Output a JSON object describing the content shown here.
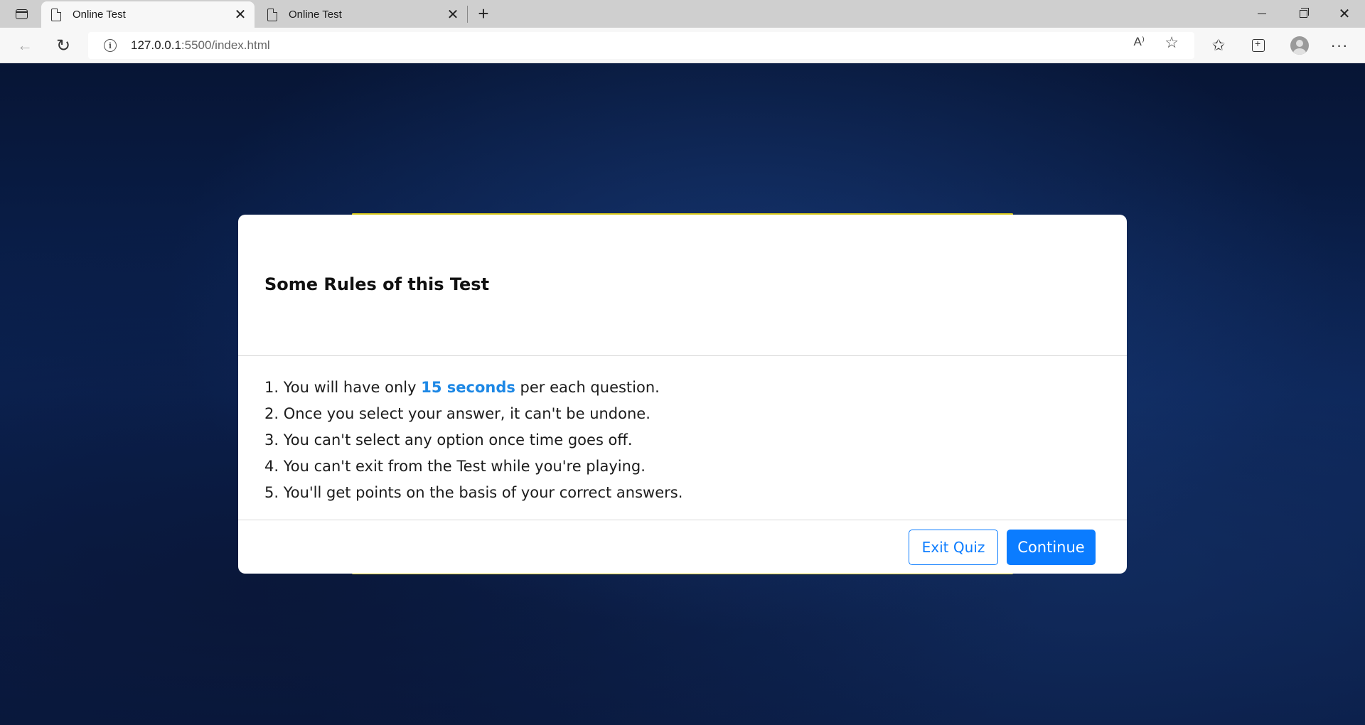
{
  "browser": {
    "tabs": [
      {
        "title": "Online Test",
        "active": true
      },
      {
        "title": "Online Test",
        "active": false
      }
    ],
    "close_glyph": "✕",
    "new_tab_glyph": "+",
    "window_close_glyph": "✕",
    "url": {
      "host": "127.0.0.1",
      "path": ":5500/index.html"
    },
    "back_glyph": "←",
    "reload_glyph": "↻",
    "info_glyph": "i",
    "read_aloud_glyph": "A⁾",
    "fav_add_glyph": "☆",
    "favorites_glyph": "✩",
    "more_glyph": "···"
  },
  "quiz": {
    "title": "Some Rules of this Test",
    "rules": [
      {
        "prefix": "1. You will have only ",
        "highlight": "15 seconds",
        "suffix": " per each question."
      },
      {
        "text": "2. Once you select your answer, it can't be undone."
      },
      {
        "text": "3. You can't select any option once time goes off."
      },
      {
        "text": "4. You can't exit from the Test while you're playing."
      },
      {
        "text": "5. You'll get points on the basis of your correct answers."
      }
    ],
    "exit_label": "Exit Quiz",
    "continue_label": "Continue",
    "accent_color": "#0b7cff",
    "highlight_color": "#1e88e5"
  }
}
